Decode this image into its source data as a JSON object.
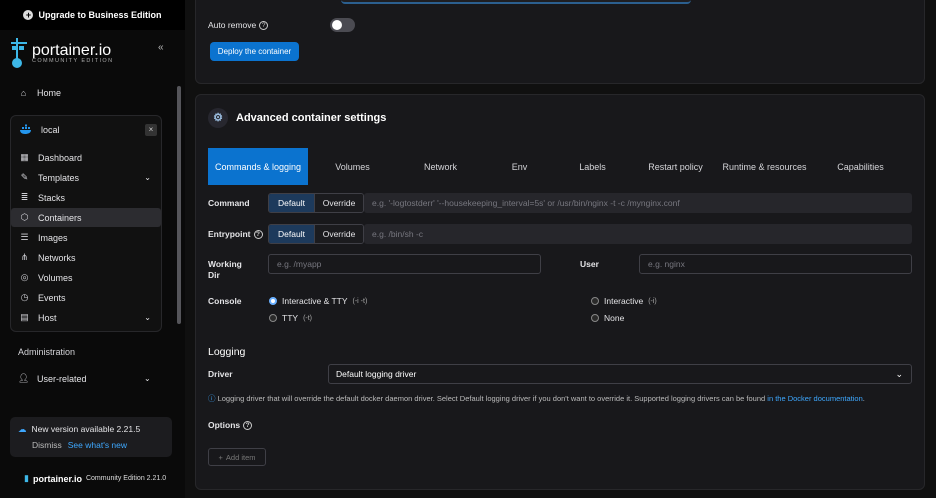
{
  "sidebar": {
    "upgrade_label": "Upgrade to Business Edition",
    "brand": "portainer.io",
    "edition": "COMMUNITY EDITION",
    "home": "Home",
    "environment": {
      "name": "local",
      "items": [
        {
          "label": "Dashboard",
          "icon": "dashboard-icon"
        },
        {
          "label": "Templates",
          "icon": "templates-icon",
          "chevron": true
        },
        {
          "label": "Stacks",
          "icon": "stacks-icon"
        },
        {
          "label": "Containers",
          "icon": "containers-icon",
          "active": true
        },
        {
          "label": "Images",
          "icon": "images-icon"
        },
        {
          "label": "Networks",
          "icon": "networks-icon"
        },
        {
          "label": "Volumes",
          "icon": "volumes-icon"
        },
        {
          "label": "Events",
          "icon": "events-icon"
        },
        {
          "label": "Host",
          "icon": "host-icon",
          "chevron": true
        }
      ]
    },
    "administration": "Administration",
    "user_related": "User-related",
    "new_version": {
      "title": "New version available 2.21.5",
      "dismiss": "Dismiss",
      "whats_new": "See what's new"
    },
    "footer": {
      "brand": "portainer.io",
      "edition": "Community Edition 2.21.0"
    }
  },
  "deploy": {
    "auto_remove_label": "Auto remove",
    "deploy_button": "Deploy the container"
  },
  "advanced": {
    "title": "Advanced container settings",
    "tabs": [
      {
        "label": "Commands & logging",
        "active": true
      },
      {
        "label": "Volumes"
      },
      {
        "label": "Network"
      },
      {
        "label": "Env"
      },
      {
        "label": "Labels"
      },
      {
        "label": "Restart policy"
      },
      {
        "label": "Runtime & resources"
      },
      {
        "label": "Capabilities"
      }
    ],
    "command": {
      "label": "Command",
      "default": "Default",
      "override": "Override",
      "placeholder": "e.g. '-logtostderr' '--housekeeping_interval=5s' or /usr/bin/nginx -t -c /mynginx.conf"
    },
    "entrypoint": {
      "label": "Entrypoint",
      "default": "Default",
      "override": "Override",
      "placeholder": "e.g. /bin/sh -c"
    },
    "working_dir": {
      "label_1": "Working",
      "label_2": "Dir",
      "placeholder": "e.g. /myapp"
    },
    "user": {
      "label": "User",
      "placeholder": "e.g. nginx"
    },
    "console": {
      "label": "Console",
      "options": [
        {
          "label": "Interactive & TTY",
          "hint": "(-i -t)",
          "selected": true
        },
        {
          "label": "TTY",
          "hint": "(-t)"
        },
        {
          "label": "Interactive",
          "hint": "(-i)"
        },
        {
          "label": "None",
          "hint": ""
        }
      ]
    },
    "logging": {
      "title": "Logging",
      "driver_label": "Driver",
      "driver_value": "Default logging driver",
      "help_text": "Logging driver that will override the default docker daemon driver. Select Default logging driver if you don't want to override it. Supported logging drivers can be found",
      "help_link": "in the Docker documentation",
      "help_end": ".",
      "options_label": "Options",
      "add_item": "Add item"
    }
  }
}
